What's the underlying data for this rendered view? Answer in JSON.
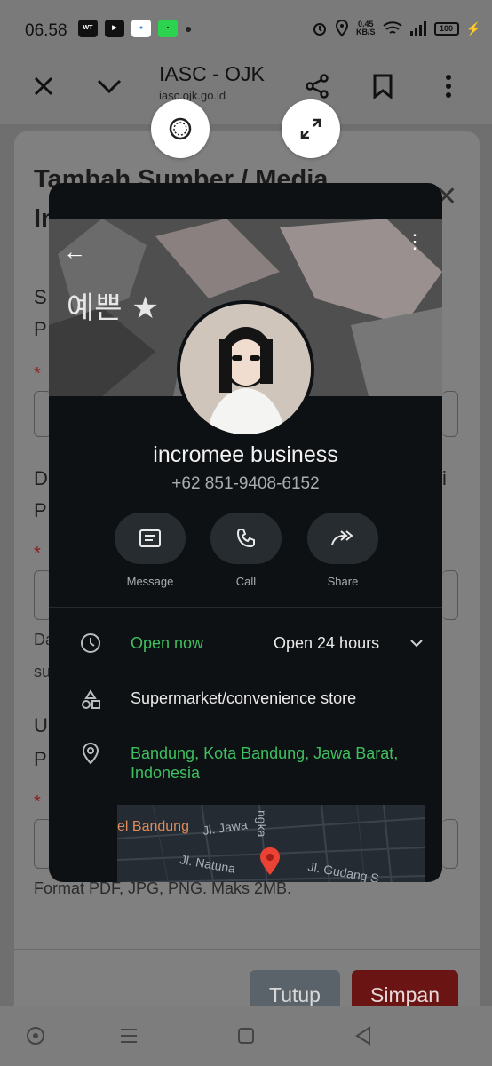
{
  "status_bar": {
    "time": "06.58",
    "app_icons": [
      "webtoon-icon",
      "youtube-icon",
      "browser-icon",
      "app-icon"
    ],
    "net_speed_value": "0.45",
    "net_speed_unit": "KB/S",
    "battery": "100"
  },
  "browser": {
    "title": "IASC - OJK",
    "url": "iasc.ojk.go.id"
  },
  "background_form": {
    "title": "Tambah Sumber / Media Informasi",
    "required_mark": "*",
    "upload_hint": "Format PDF, JPG, PNG. Maks 2MB.",
    "buttons": {
      "close": "Tutup",
      "save": "Simpan"
    }
  },
  "contact_card": {
    "banner_text": "예쁜 ★",
    "name": "incromee business",
    "phone": "+62 851-9408-6152",
    "actions": [
      {
        "label": "Message",
        "icon": "message-icon"
      },
      {
        "label": "Call",
        "icon": "phone-icon"
      },
      {
        "label": "Share",
        "icon": "share-icon"
      }
    ],
    "hours": {
      "status": "Open now",
      "detail": "Open 24 hours"
    },
    "category": "Supermarket/convenience store",
    "address": "Bandung, Kota Bandung, Jawa Barat, Indonesia",
    "map_labels": [
      "el Bandung",
      "Jl. Jawa",
      "Jl. Natuna",
      "Jl. Gudang S",
      "ngka"
    ]
  },
  "colors": {
    "overlay_bg": "#0d1114",
    "accent_green": "#3fbf5f",
    "save_button": "#6b1414",
    "close_button": "#5b636a"
  }
}
